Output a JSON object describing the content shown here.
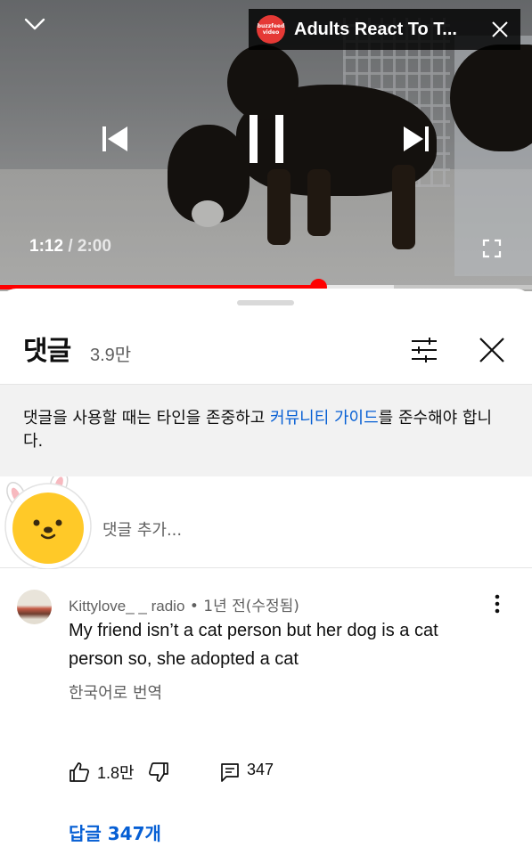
{
  "player": {
    "channel_logo_text": "buzzfeed video",
    "video_title": "Adults React To T...",
    "current_time": "1:12",
    "time_separator": "/",
    "duration": "2:00",
    "progress_fraction": 0.6,
    "buffer_fraction": 0.74,
    "accent_color": "#ff0000"
  },
  "comments_panel": {
    "title": "댓글",
    "count": "3.9만",
    "notice_prefix": "댓글을 사용할 때는 타인을 존중하고 ",
    "notice_link": "커뮤니티 가이드",
    "notice_suffix": "를 준수해야 합니다.",
    "add_comment_placeholder": "댓글 추가...",
    "link_color": "#065fd4"
  },
  "comment": {
    "author": "Kittylove_ _ radio",
    "meta_separator": "•",
    "time_ago": "1년 전(수정됨)",
    "text": "My friend isn’t a cat person but her dog is a cat person so, she adopted a cat",
    "translate_label": "한국어로 번역",
    "like_count": "1.8만",
    "reply_count": "347",
    "replies_link": "답글 347개"
  },
  "icons": {
    "collapse": "chevron-down-icon",
    "pip_close": "close-icon",
    "previous": "skip-previous-icon",
    "pause": "pause-icon",
    "next": "skip-next-icon",
    "fullscreen": "fullscreen-icon",
    "sort": "sliders-icon",
    "panel_close": "close-icon",
    "more": "more-vertical-icon",
    "like": "thumbs-up-icon",
    "dislike": "thumbs-down-icon",
    "reply": "comment-icon"
  }
}
